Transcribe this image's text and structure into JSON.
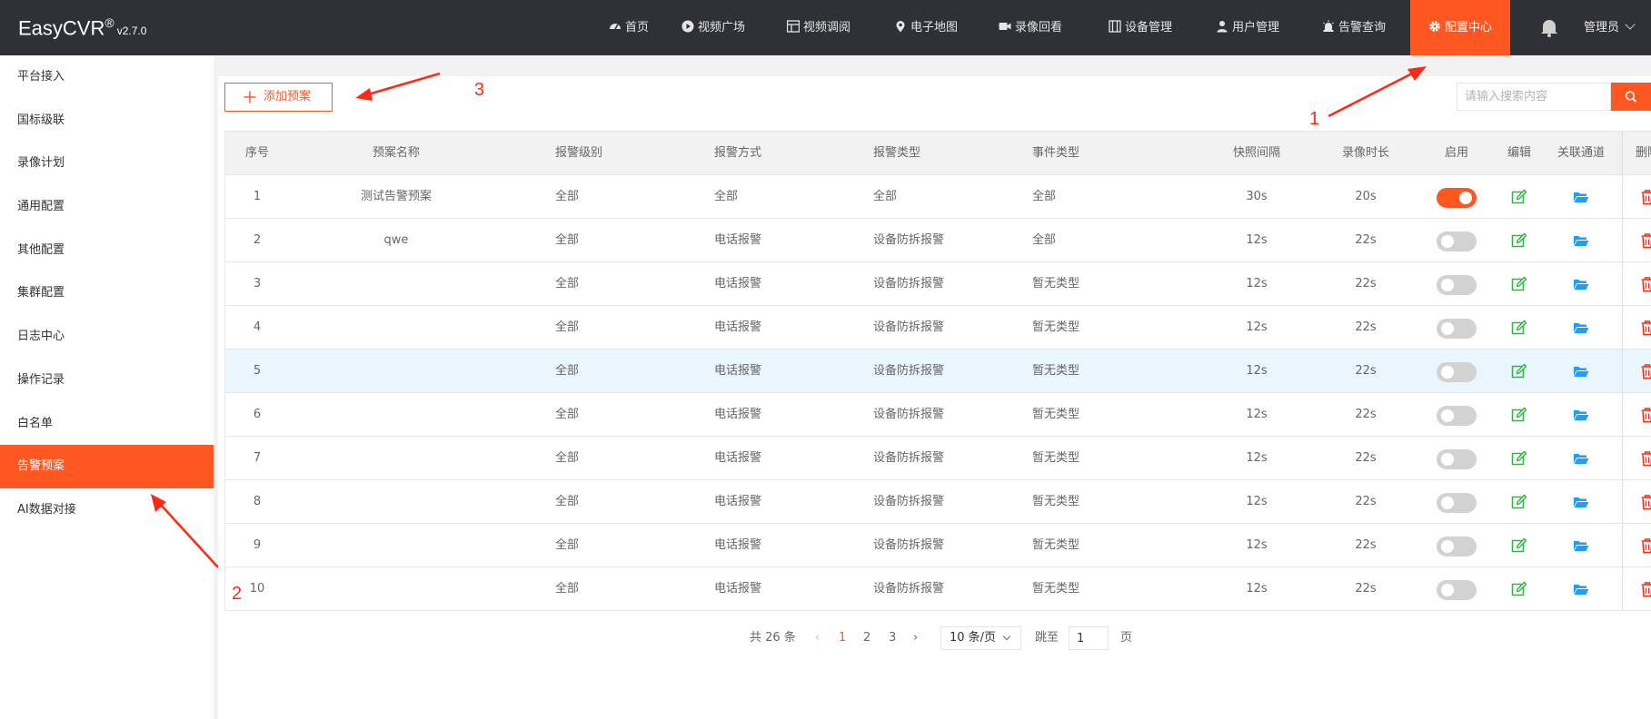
{
  "app": {
    "name": "EasyCVR",
    "reg": "®",
    "version": "v2.7.0"
  },
  "nav": [
    {
      "label": "首页",
      "icon": "dashboard-icon"
    },
    {
      "label": "视频广场",
      "icon": "play-icon"
    },
    {
      "label": "视频调阅",
      "icon": "grid-icon"
    },
    {
      "label": "电子地图",
      "icon": "map-pin-icon"
    },
    {
      "label": "录像回看",
      "icon": "video-camera-icon"
    },
    {
      "label": "设备管理",
      "icon": "device-icon"
    },
    {
      "label": "用户管理",
      "icon": "user-icon"
    },
    {
      "label": "告警查询",
      "icon": "alarm-icon"
    },
    {
      "label": "配置中心",
      "icon": "gear-icon"
    }
  ],
  "user": {
    "name": "管理员"
  },
  "sidebar": [
    {
      "label": "平台接入"
    },
    {
      "label": "国标级联"
    },
    {
      "label": "录像计划"
    },
    {
      "label": "通用配置"
    },
    {
      "label": "其他配置"
    },
    {
      "label": "集群配置"
    },
    {
      "label": "日志中心"
    },
    {
      "label": "操作记录"
    },
    {
      "label": "白名单"
    },
    {
      "label": "告警预案"
    },
    {
      "label": "AI数据对接"
    }
  ],
  "toolbar": {
    "add_label": "添加预案",
    "search_placeholder": "请输入搜索内容"
  },
  "table": {
    "headers": [
      "序号",
      "预案名称",
      "报警级别",
      "报警方式",
      "报警类型",
      "事件类型",
      "快照间隔",
      "录像时长",
      "启用",
      "编辑",
      "关联通道",
      "删除"
    ],
    "rows": [
      {
        "no": "1",
        "name": "测试告警预案",
        "level": "全部",
        "method": "全部",
        "type": "全部",
        "event": "全部",
        "snap": "30s",
        "rec": "20s",
        "enabled": true
      },
      {
        "no": "2",
        "name": "qwe",
        "level": "全部",
        "method": "电话报警",
        "type": "设备防拆报警",
        "event": "全部",
        "snap": "12s",
        "rec": "22s",
        "enabled": false
      },
      {
        "no": "3",
        "name": "",
        "level": "全部",
        "method": "电话报警",
        "type": "设备防拆报警",
        "event": "暂无类型",
        "snap": "12s",
        "rec": "22s",
        "enabled": false
      },
      {
        "no": "4",
        "name": "",
        "level": "全部",
        "method": "电话报警",
        "type": "设备防拆报警",
        "event": "暂无类型",
        "snap": "12s",
        "rec": "22s",
        "enabled": false
      },
      {
        "no": "5",
        "name": "",
        "level": "全部",
        "method": "电话报警",
        "type": "设备防拆报警",
        "event": "暂无类型",
        "snap": "12s",
        "rec": "22s",
        "enabled": false
      },
      {
        "no": "6",
        "name": "",
        "level": "全部",
        "method": "电话报警",
        "type": "设备防拆报警",
        "event": "暂无类型",
        "snap": "12s",
        "rec": "22s",
        "enabled": false
      },
      {
        "no": "7",
        "name": "",
        "level": "全部",
        "method": "电话报警",
        "type": "设备防拆报警",
        "event": "暂无类型",
        "snap": "12s",
        "rec": "22s",
        "enabled": false
      },
      {
        "no": "8",
        "name": "",
        "level": "全部",
        "method": "电话报警",
        "type": "设备防拆报警",
        "event": "暂无类型",
        "snap": "12s",
        "rec": "22s",
        "enabled": false
      },
      {
        "no": "9",
        "name": "",
        "level": "全部",
        "method": "电话报警",
        "type": "设备防拆报警",
        "event": "暂无类型",
        "snap": "12s",
        "rec": "22s",
        "enabled": false
      },
      {
        "no": "10",
        "name": "",
        "level": "全部",
        "method": "电话报警",
        "type": "设备防拆报警",
        "event": "暂无类型",
        "snap": "12s",
        "rec": "22s",
        "enabled": false
      }
    ]
  },
  "pagination": {
    "total_label": "共 26 条",
    "pages": [
      "1",
      "2",
      "3"
    ],
    "current": "1",
    "page_size": "10 条/页",
    "goto_label": "跳至",
    "goto_value": "1",
    "page_suffix": "页"
  },
  "annotations": [
    "1",
    "2",
    "3"
  ],
  "colors": {
    "accent": "#ff5722",
    "topbar": "#2f3136",
    "edit": "#2db83d",
    "folder": "#1e9fff",
    "delete": "#ff2a16",
    "annotation": "#ff2a16"
  }
}
